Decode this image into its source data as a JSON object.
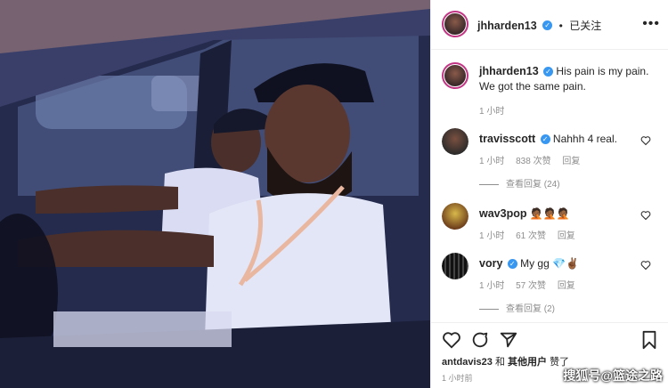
{
  "post": {
    "author": "jhharden13",
    "follow_state": "已关注",
    "separator": "•",
    "more": "•••"
  },
  "caption": {
    "author": "jhharden13",
    "text": "His pain is my pain. We got the same pain.",
    "time": "1 小时"
  },
  "comments": [
    {
      "author": "travisscott",
      "text": "Nahhh 4 real.",
      "time": "1 小时",
      "likes": "838 次赞",
      "reply": "回复",
      "view_replies": "查看回复 (24)"
    },
    {
      "author": "wav3pop",
      "text": "🤦🏾🤦🏾🤦🏾",
      "time": "1 小时",
      "likes": "61 次赞",
      "reply": "回复"
    },
    {
      "author": "vory",
      "text": "My gg 💎✌🏾",
      "time": "1 小时",
      "likes": "57 次赞",
      "reply": "回复",
      "view_replies": "查看回复 (2)"
    }
  ],
  "likes": {
    "first": "antdavis23",
    "and": "和",
    "others": "其他用户",
    "suffix": "赞了"
  },
  "footer_time": "1 小时前",
  "watermark": "搜狐号@篮途之路",
  "colors": {
    "accent": "#3897f0",
    "muted": "#8e8e8e",
    "text": "#262626"
  }
}
